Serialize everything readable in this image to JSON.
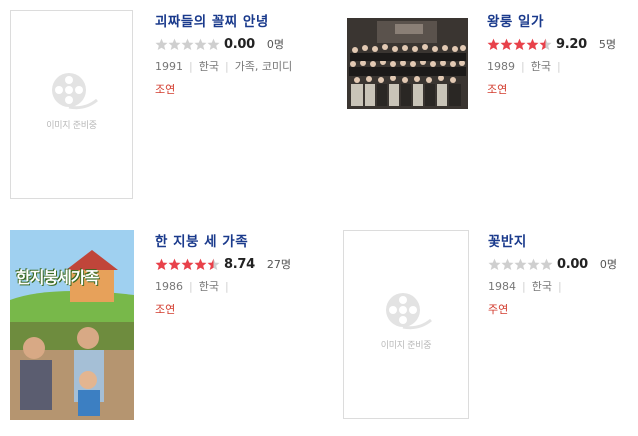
{
  "placeholder_text": "이미지 준비중",
  "items": [
    {
      "title": "괴짜들의 꼴찌 안녕",
      "stars": [
        0,
        0,
        0,
        0,
        0
      ],
      "score": "0.00",
      "count": "0명",
      "year": "1991",
      "country": "한국",
      "genre": "가족, 코미디",
      "role": "조연",
      "poster": "placeholder"
    },
    {
      "title": "왕룽 일가",
      "stars": [
        1,
        1,
        1,
        1,
        0.5
      ],
      "score": "9.20",
      "count": "5명",
      "year": "1989",
      "country": "한국",
      "genre": "",
      "role": "조연",
      "poster": "group-photo"
    },
    {
      "title": "한 지붕 세 가족",
      "stars": [
        1,
        1,
        1,
        1,
        0.5
      ],
      "score": "8.74",
      "count": "27명",
      "year": "1986",
      "country": "한국",
      "genre": "",
      "role": "조연",
      "poster": "family-poster",
      "poster_logo": "한지붕세가족"
    },
    {
      "title": "꽃반지",
      "stars": [
        0,
        0,
        0,
        0,
        0
      ],
      "score": "0.00",
      "count": "0명",
      "year": "1984",
      "country": "한국",
      "genre": "",
      "role": "주연",
      "poster": "placeholder"
    }
  ],
  "colors": {
    "title": "#1a3a8c",
    "star_on": "#e8414a",
    "star_off": "#cfcfcf",
    "role": "#d23a2c"
  }
}
